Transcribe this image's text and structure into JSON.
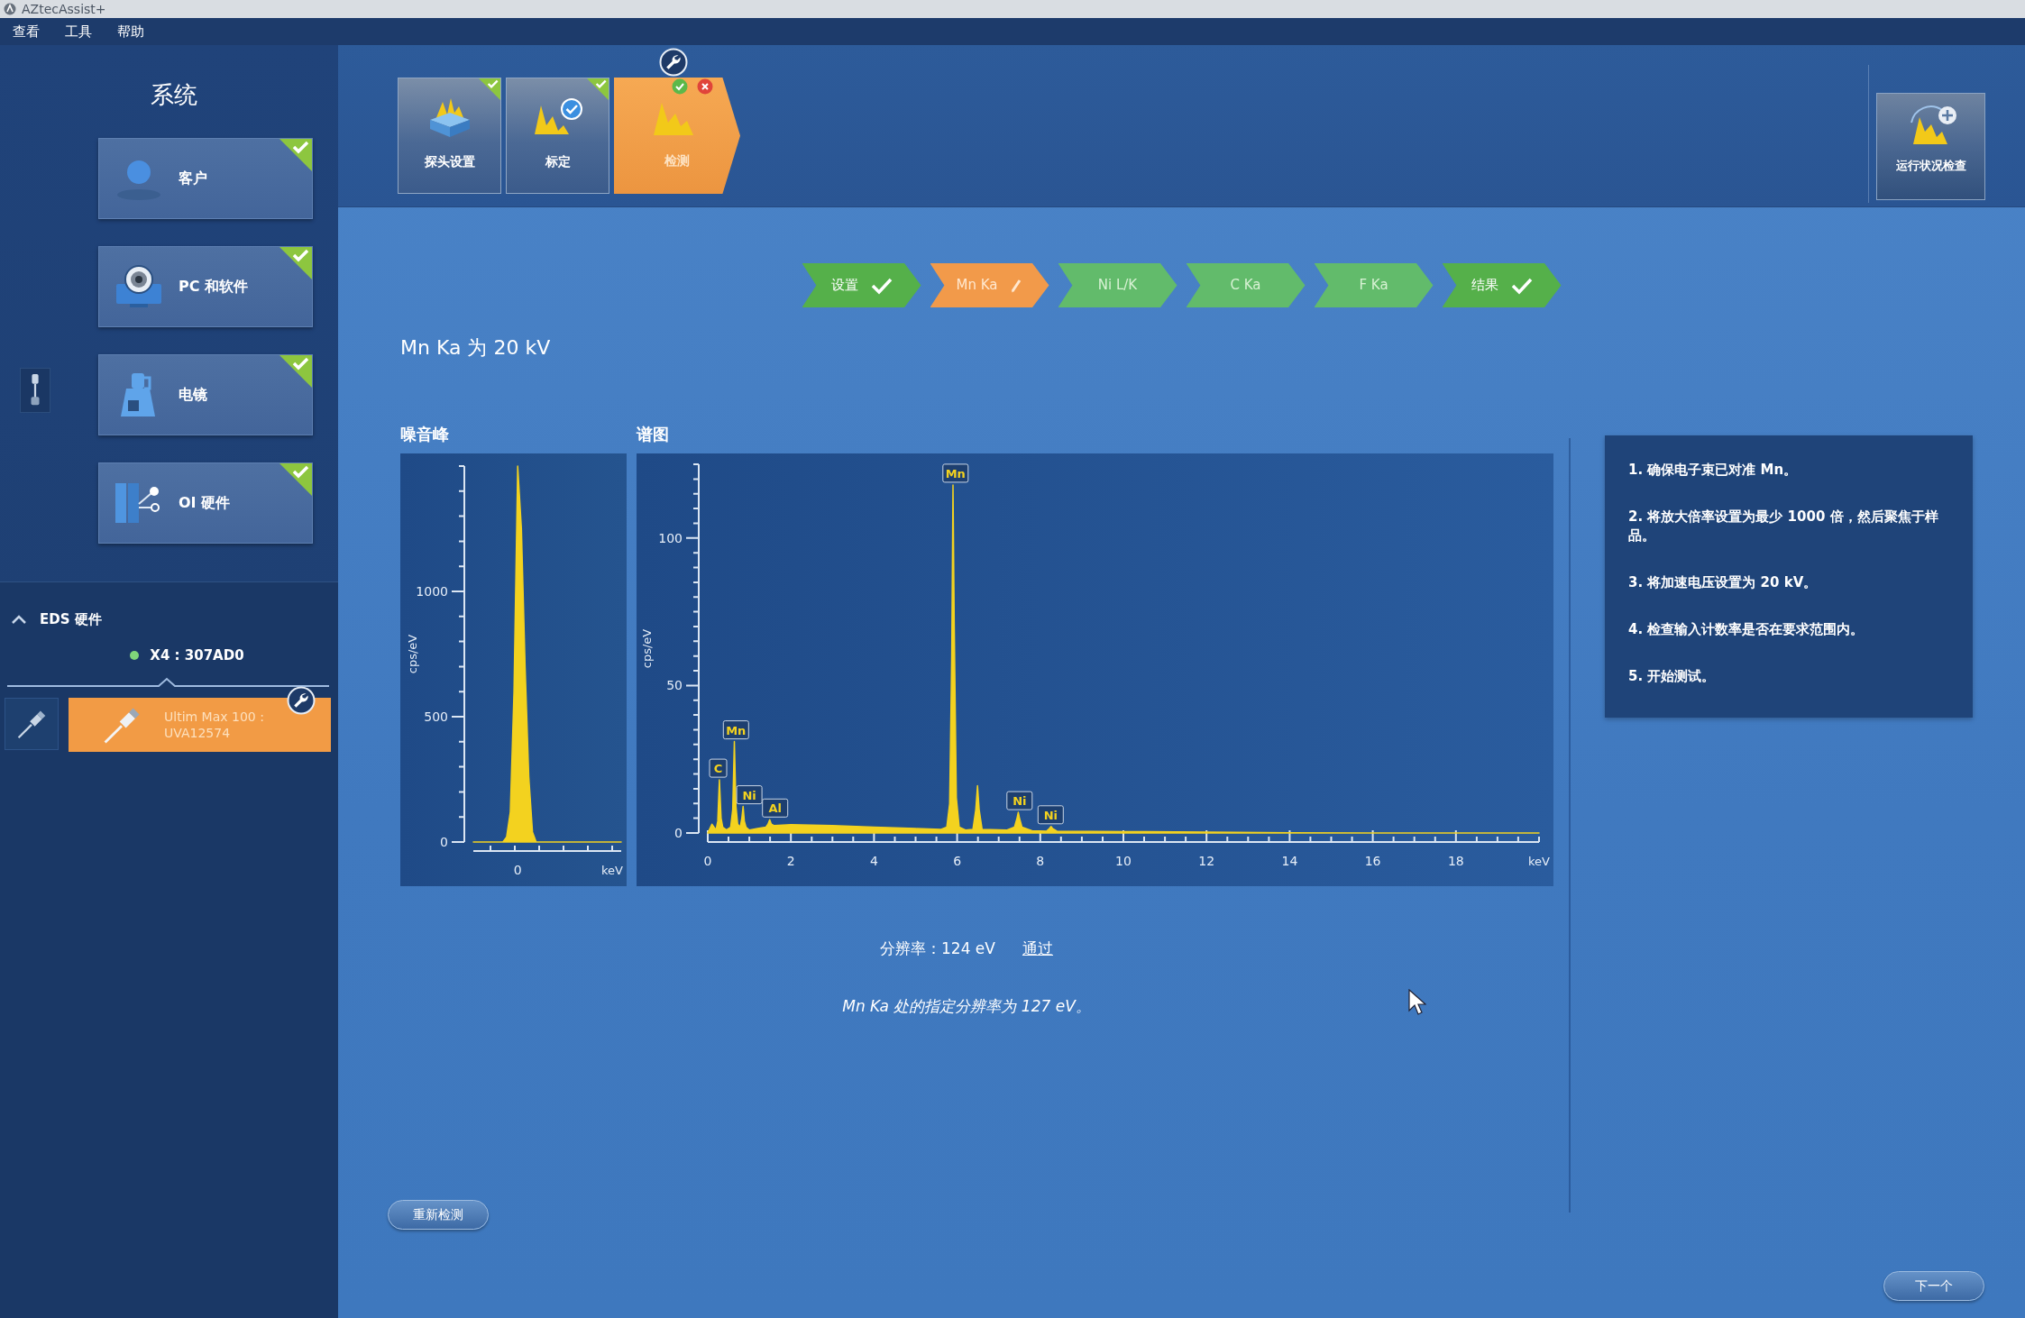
{
  "window": {
    "title": "AZtecAssist+"
  },
  "menu": [
    "查看",
    "工具",
    "帮助"
  ],
  "sidebar": {
    "title": "系统",
    "items": [
      {
        "label": "客户",
        "checked": true
      },
      {
        "label": "PC 和软件",
        "checked": true
      },
      {
        "label": "电镜",
        "checked": true
      },
      {
        "label": "OI 硬件",
        "checked": true
      }
    ],
    "eds": {
      "title": "EDS 硬件",
      "expanded": true,
      "device": {
        "label": "X4 : 307AD0",
        "color": "#7fd67a"
      },
      "detector": {
        "name": "Ultim Max 100 :",
        "serial": "UVA12574",
        "selected": true
      }
    }
  },
  "tabs": [
    {
      "label": "探头设置",
      "selected": false,
      "checked": true
    },
    {
      "label": "标定",
      "selected": false,
      "checked": true
    },
    {
      "label": "检测",
      "selected": true,
      "checked": false
    }
  ],
  "health_check": {
    "label": "运行状况检查"
  },
  "steps": [
    {
      "label": "设置",
      "selected": false,
      "checked": true
    },
    {
      "label": "Mn Ka",
      "selected": true,
      "checked": false
    },
    {
      "label": "Ni L/K",
      "selected": false,
      "checked": false
    },
    {
      "label": "C Ka",
      "selected": false,
      "checked": false
    },
    {
      "label": "F Ka",
      "selected": false,
      "checked": false
    },
    {
      "label": "结果",
      "selected": false,
      "checked": true
    }
  ],
  "heading": "Mn Ka 为 20 kV",
  "noise_chart": {
    "chart_data": {
      "type": "area",
      "title": "噪音峰",
      "xlabel": "keV",
      "ylabel": "cps/eV",
      "series": [
        {
          "color": "#f3d21f",
          "values": [
            0,
            0,
            0,
            0,
            0,
            0,
            0,
            0,
            0,
            20,
            120,
            600,
            1500,
            1250,
            700,
            260,
            40,
            0,
            0,
            0,
            0,
            0,
            0,
            0,
            0,
            0,
            0,
            0,
            0,
            0,
            0,
            0,
            0,
            0,
            0,
            0,
            0,
            0,
            0,
            0,
            0
          ]
        }
      ],
      "ylim": [
        0,
        1500
      ],
      "yticks": [
        0,
        500,
        1000
      ],
      "annotations": [
        {
          "text": "0"
        }
      ]
    }
  },
  "spectrum_chart": {
    "chart_data": {
      "type": "area",
      "title": "谱图",
      "xlabel": "keV",
      "ylabel": "cps/eV",
      "x": [
        0,
        0.1,
        0.2,
        0.24,
        0.28,
        0.32,
        0.36,
        0.45,
        0.55,
        0.6,
        0.64,
        0.68,
        0.72,
        0.78,
        0.82,
        0.85,
        0.88,
        0.92,
        1.0,
        1.2,
        1.4,
        1.45,
        1.49,
        1.53,
        1.6,
        2,
        3,
        4,
        5,
        5.6,
        5.75,
        5.82,
        5.87,
        5.9,
        5.93,
        5.98,
        6.05,
        6.2,
        6.38,
        6.45,
        6.49,
        6.53,
        6.6,
        7.2,
        7.38,
        7.44,
        7.47,
        7.5,
        7.56,
        7.8,
        8.15,
        8.22,
        8.26,
        8.3,
        8.4,
        10,
        12,
        14,
        16,
        18,
        20
      ],
      "series": [
        {
          "color": "#f3d21f",
          "values": [
            0,
            3,
            1,
            4,
            18,
            5,
            2,
            1,
            2,
            8,
            31,
            9,
            3,
            2,
            5,
            9,
            4,
            2,
            1,
            1.5,
            2,
            3,
            4.5,
            3,
            2.5,
            2.8,
            2.5,
            2,
            1.5,
            1.2,
            2,
            10,
            60,
            118,
            70,
            12,
            2,
            1,
            1.2,
            8,
            16,
            8,
            1.2,
            1,
            2,
            5,
            7,
            5,
            2,
            0.8,
            0.6,
            1.5,
            2.2,
            1.5,
            0.6,
            0.5,
            0.3,
            0.1,
            0,
            0,
            0
          ]
        }
      ],
      "xlim": [
        0,
        20
      ],
      "ylim": [
        0,
        125
      ],
      "xticks": [
        0,
        2,
        4,
        6,
        8,
        10,
        12,
        14,
        16,
        18
      ],
      "yticks": [
        0,
        50,
        100
      ],
      "annotations": [
        {
          "x": 5.96,
          "text": "Mn"
        },
        {
          "x": 0.25,
          "text": "C"
        },
        {
          "x": 0.68,
          "text": "Mn"
        },
        {
          "x": 1.0,
          "text": "Ni"
        },
        {
          "x": 1.62,
          "text": "Al"
        },
        {
          "x": 7.5,
          "text": "Ni"
        },
        {
          "x": 8.25,
          "text": "Ni"
        }
      ]
    }
  },
  "result": {
    "resolution": "分辨率：124 eV",
    "verdict": "通过",
    "note": "Mn Ka 处的指定分辨率为 127 eV。"
  },
  "instructions": [
    "1. 确保电子束已对准 Mn。",
    "2. 将放大倍率设置为最少 1000 倍，然后聚焦于样品。",
    "3. 将加速电压设置为 20 kV。",
    "4. 检查输入计数率是否在要求范围内。",
    "5. 开始测试。"
  ],
  "buttons": {
    "retest": "重新检测",
    "next": "下一个"
  }
}
